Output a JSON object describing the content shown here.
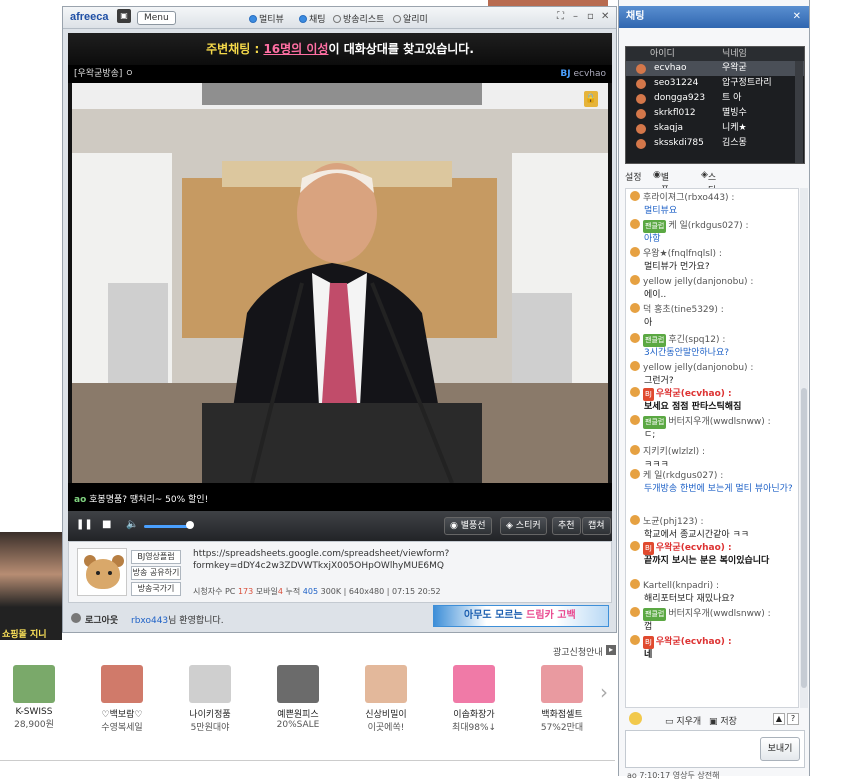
{
  "player": {
    "nav": [
      "멀티뷰",
      "채팅",
      "방송리스트",
      "알리미"
    ],
    "menu_label": "Menu",
    "notice_prefix": "주변채팅 : ",
    "notice_highlight": "16명의 이성",
    "notice_suffix": "이 대화상대를 찾고있습니다.",
    "broadcast_title": "[우왁굳방송] ㅇ",
    "bj_label": "BJ",
    "bj_id": "ecvhao",
    "caption_tag": "ao",
    "caption_text": "호봉명품? 땡처리~ 50% 할인!",
    "buttons": {
      "balloon": "별풍선",
      "sticker": "스티커",
      "recommend": "추천",
      "capture": "캡쳐"
    },
    "side_buttons": [
      "BJ영상플럽",
      "방송 공유하기",
      "방송국가기"
    ],
    "url": "https://spreadsheets.google.com/spreadsheet/viewform?formkey=dDY4c2w3ZDVWTkxjX005OHpOWlhyMUE6MQ",
    "stats": {
      "viewers_label": "시청자수 PC",
      "viewers_pc": "173",
      "mobile_label": "모바일",
      "viewers_mobile": "4",
      "total_label": "누적",
      "total": "405",
      "quality": "300K | 640x480 | 07:15 20:52"
    },
    "logout": "로그아웃",
    "welcome_user": "rbxo443",
    "welcome_text": "님 환영합니다.",
    "banner_a": "아무도 모르는 ",
    "banner_b": "드림카 고백"
  },
  "background": {
    "person_label": "쇼핑몰 지니",
    "ad_label": "광고신청안내",
    "ads": [
      {
        "name": "K-SWISS",
        "price": "28,900원",
        "color": "#7aa96a"
      },
      {
        "name": "♡백보람♡",
        "price": "수영복세일",
        "color": "#d07a6a"
      },
      {
        "name": "나이키정품",
        "price": "5만원대야",
        "color": "#cfcfcf"
      },
      {
        "name": "예쁜원피스",
        "price": "20%SALE",
        "color": "#6b6b6b"
      },
      {
        "name": "신상비밀이",
        "price": "이곳에쏙!",
        "color": "#e3b89b"
      },
      {
        "name": "이솝화장가",
        "price": "최대98%↓",
        "color": "#f07aa7"
      },
      {
        "name": "백화점셀트",
        "price": "57%2만대",
        "color": "#e99aa0"
      }
    ]
  },
  "chat": {
    "title": "채팅",
    "col_id": "아이디",
    "col_nick": "닉네임",
    "users": [
      {
        "id": "ecvhao",
        "nick": "우왁굳"
      },
      {
        "id": "seo31224",
        "nick": "압구정트라리"
      },
      {
        "id": "dongga923",
        "nick": "트 아"
      },
      {
        "id": "skrkfl012",
        "nick": "멸빙수"
      },
      {
        "id": "skaqja",
        "nick": "니케★"
      },
      {
        "id": "sksskdi785",
        "nick": "김스몽"
      }
    ],
    "tabs": {
      "settings": "설정",
      "balloon": "별풍선",
      "sticker": "스티커"
    },
    "messages": [
      {
        "nick": "후라이져그(rbxo443) :",
        "text": "멀티뷰요"
      },
      {
        "nick": "케 일(rkdgus027) :",
        "text": "아항"
      },
      {
        "nick": "우왕★(fnqlfnqlsl) :",
        "text": "멀티뷰가 먼가요?"
      },
      {
        "nick": "yellow jelly(danjonobu) :",
        "text": "에이.."
      },
      {
        "nick": "덕 홍초(tine5329) :",
        "text": "아"
      },
      {
        "nick": "후긴(spq12) :",
        "text": "3시간동안말안하나요?"
      },
      {
        "nick": "yellow jelly(danjonobu) :",
        "text": "그런거?"
      },
      {
        "nick": "우왁굳(ecvhao) :",
        "text": "보세요 점점 판타스틱해짐"
      },
      {
        "nick": "버터지우개(wwdlsnww) :",
        "text": "ㄷ;"
      },
      {
        "nick": "지키키(wlzlzl) :",
        "text": "ㅋㅋㅋ"
      },
      {
        "nick": "케 일(rkdgus027) :",
        "text": "두개방송 한번에 보는게 멀티 뷰아닌가?"
      },
      {
        "nick": "노균(phj123) :",
        "text": "학교에서 종교시간같아 ㅋㅋ"
      },
      {
        "nick": "우왁굳(ecvhao) :",
        "text": "끝까지 보시는 분은 복이있습니다"
      },
      {
        "nick": "Kartell(knpadri) :",
        "text": "해리포터보다 재밌나요?"
      },
      {
        "nick": "버터지우개(wwdlsnww) :",
        "text": "껍"
      },
      {
        "nick": "우왁굳(ecvhao) :",
        "text": "네"
      }
    ],
    "fan_label": "팬클럽",
    "bj_tag": "BJ",
    "tools": {
      "clear": "지우개",
      "save": "저장"
    },
    "send": "보내기",
    "footer": "ao 7:10:17 영상두 상전해 "
  }
}
